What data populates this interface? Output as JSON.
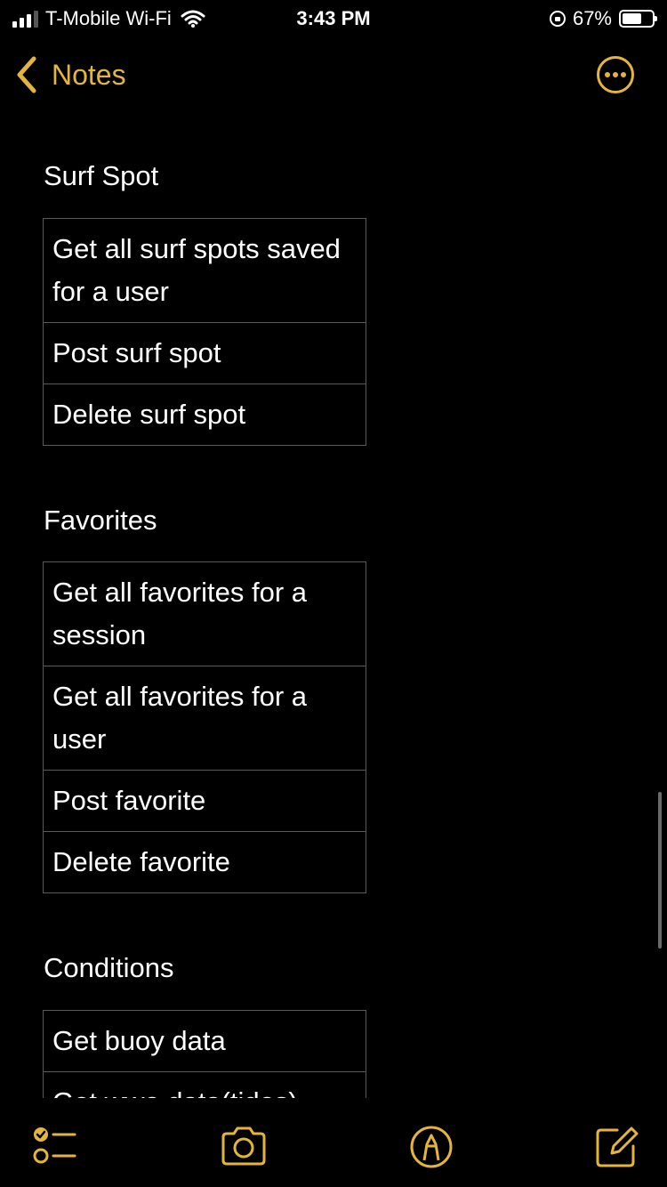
{
  "status_bar": {
    "carrier": "T-Mobile Wi-Fi",
    "time": "3:43 PM",
    "battery_percent": "67%",
    "battery_level": 0.67
  },
  "nav": {
    "back_label": "Notes",
    "back_icon": "chevron-left-icon",
    "more_icon": "ellipsis-circle-icon",
    "accent_color": "#e3b53b"
  },
  "sections": [
    {
      "title": "Surf Spot",
      "rows": [
        "Get all surf spots saved for a user",
        "Post surf spot",
        "Delete surf spot"
      ]
    },
    {
      "title": "Favorites",
      "rows": [
        "Get all favorites for a session",
        "Get all favorites for a user",
        "Post favorite",
        "Delete favorite"
      ]
    },
    {
      "title": "Conditions",
      "rows": [
        "Get buoy data",
        "Get wwo data(tides)"
      ]
    }
  ],
  "toolbar": {
    "items": [
      "checklist-icon",
      "camera-icon",
      "markup-pen-icon",
      "compose-icon"
    ]
  }
}
